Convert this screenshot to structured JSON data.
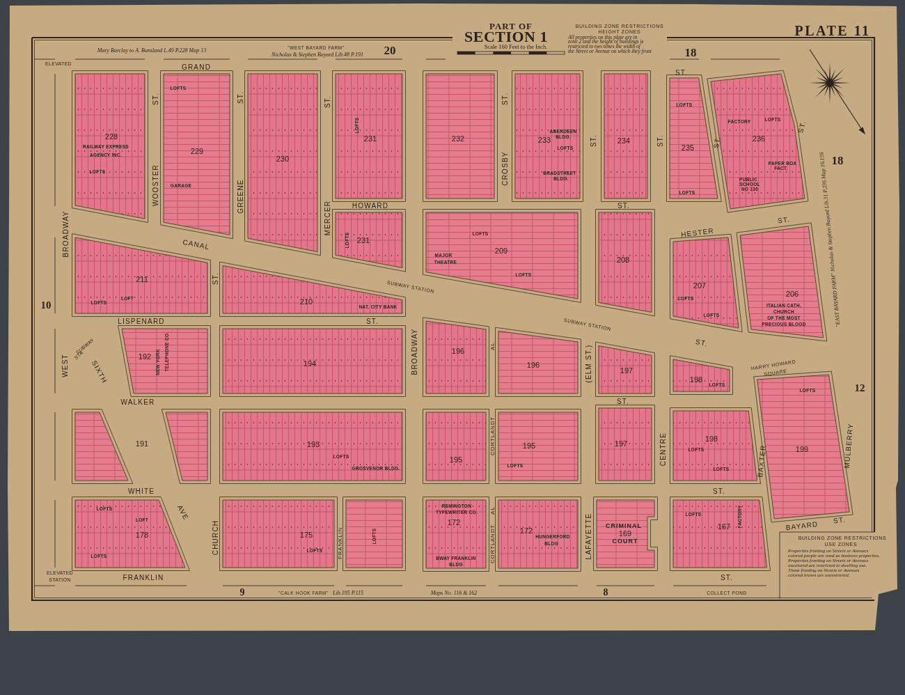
{
  "header": {
    "part_of": "PART OF",
    "section": "SECTION 1",
    "scale": "Scale 160 Feet to the Inch.",
    "plate": "PLATE 11"
  },
  "height_zones": {
    "title": "BUILDING ZONE RESTRICTIONS",
    "subtitle": "HEIGHT ZONES",
    "lines": [
      "All properties on this plate are in",
      "zone 2 and the height of buildings is",
      "restricted to two times the width of",
      "the Street or Avenue on which they front"
    ]
  },
  "map": {
    "adjoining_plates": [
      "20",
      "18",
      "18",
      "10",
      "12",
      "9",
      "8"
    ],
    "land_records": [
      "Mary Barclay to A. Bunsland L.49 P.228 Map 13",
      "\"WEST BAYARD FARM\"",
      "Nicholas & Stephen Bayard Lib.48 P.191",
      "\"EAST BAYARD FARM\" Nicholas & Stephen Bayard Lib.31 P.236 Map 16.156",
      "\"CALK HOOK FARM\"",
      "Lib.195 P.115",
      "Maps No. 116 & 162",
      "COLLECT POND"
    ],
    "street_labels": [
      "ELEVATED",
      "GRAND",
      "ST.",
      "ST.",
      "WOOSTER",
      "ST.",
      "GREENE",
      "ST.",
      "MERCER",
      "ST.",
      "CROSBY",
      "ST.",
      "ST.",
      "ST.",
      "ST.",
      "HOWARD",
      "ST.",
      "HESTER",
      "ST.",
      "CANAL",
      "ST.",
      "SUBWAY STATION",
      "SUBWAY STATION",
      "LISPENARD",
      "ST.",
      "WEST",
      "BROADWAY",
      "BROADWAY",
      "SUBWAY",
      "STA",
      "SIXTH",
      "WALKER",
      "ST.",
      "WHITE",
      "AVE",
      "ST.",
      "FRANKLIN",
      "ST.",
      "CHURCH",
      "ST.",
      "FRANKLIN",
      "AL",
      "CORTLANDT",
      "AL",
      "CORTLANDT",
      "(ELM ST.)",
      "LAFAYETTE",
      "CENTRE",
      "BAXTER",
      "MULBERRY",
      "HARRY HOWARD",
      "SQUARE",
      "BAYARD",
      "ST.",
      "ELEVATED",
      "STATION"
    ],
    "blocks": [
      {
        "number": "228",
        "labels": [
          "RAILWAY EXPRESS",
          "AGENCY INC.",
          "LOFTS"
        ]
      },
      {
        "number": "229",
        "labels": [
          "LOFTS",
          "GARAGE"
        ]
      },
      {
        "number": "230"
      },
      {
        "number": "231",
        "labels": [
          "LOFTS"
        ]
      },
      {
        "number": "232"
      },
      {
        "number": "233",
        "labels": [
          "ABERDEEN",
          "BLDG.",
          "LOFTS",
          "BRADSTREET",
          "BLDG."
        ]
      },
      {
        "number": "234"
      },
      {
        "number": "235",
        "labels": [
          "LOFTS",
          "LOFTS"
        ]
      },
      {
        "number": "236",
        "labels": [
          "FACTORY",
          "LOFTS",
          "PAPER BOX",
          "FACT.",
          "PUBLIC",
          "SCHOOL",
          "NO 130"
        ]
      },
      {
        "number": "231",
        "labels": [
          "LOFTS"
        ]
      },
      {
        "number": "209",
        "labels": [
          "MAJOR",
          "THEATRE",
          "LOFTS",
          "LOFTS"
        ]
      },
      {
        "number": "208"
      },
      {
        "number": "207",
        "labels": [
          "LOFTS",
          "LOFTS"
        ]
      },
      {
        "number": "206",
        "labels": [
          "ITALIAN CATH.",
          "CHURCH",
          "OF THE MOST",
          "PRECIOUS BLOOD"
        ]
      },
      {
        "number": "211",
        "labels": [
          "LOFT",
          "LOFTS"
        ]
      },
      {
        "number": "210",
        "labels": [
          "NAT. CITY BANK"
        ]
      },
      {
        "number": "192",
        "labels": [
          "NEW YORK",
          "TELEPHONE CO."
        ]
      },
      {
        "number": "194"
      },
      {
        "number": "196"
      },
      {
        "number": "196"
      },
      {
        "number": "197"
      },
      {
        "number": "198",
        "labels": [
          "LOFTS"
        ]
      },
      {
        "number": "191"
      },
      {
        "number": "193",
        "labels": [
          "LOFTS",
          "GROSVENOR BLDG."
        ]
      },
      {
        "number": "195"
      },
      {
        "number": "195",
        "labels": [
          "LOFTS"
        ]
      },
      {
        "number": "197"
      },
      {
        "number": "198",
        "labels": [
          "LOFTS",
          "LOFTS"
        ]
      },
      {
        "number": "199",
        "labels": [
          "LOFTS"
        ]
      },
      {
        "number": "178",
        "labels": [
          "LOFTS",
          "LOFT",
          "LOFTS"
        ]
      },
      {
        "number": "175",
        "labels": [
          "LOFTS"
        ]
      },
      {
        "labels": [
          "LOFTS"
        ]
      },
      {
        "number": "172",
        "labels": [
          "REMINGTON",
          "TYPEWRITER CO.",
          "BWAY FRANKLIN",
          "BLDG"
        ]
      },
      {
        "number": "172",
        "labels": [
          "HUNGERFORD",
          "BLDG"
        ]
      },
      {
        "number": "169",
        "labels": [
          "CRIMINAL",
          "COURT"
        ]
      },
      {
        "number": "167",
        "labels": [
          "LOFTS",
          "FACTORY"
        ]
      }
    ]
  },
  "use_zones": {
    "title": "BUILDING ZONE RESTRICTIONS",
    "subtitle": "USE ZONES",
    "lines": [
      "Properties fronting on Streets or Avenues",
      "colored purple are used as business properties.",
      "Properties fronting on Streets or Avenues",
      "uncolored are restricted to dwelling use.",
      "Those fronting on Streets or Avenues",
      "colored brown are unrestricted."
    ]
  }
}
